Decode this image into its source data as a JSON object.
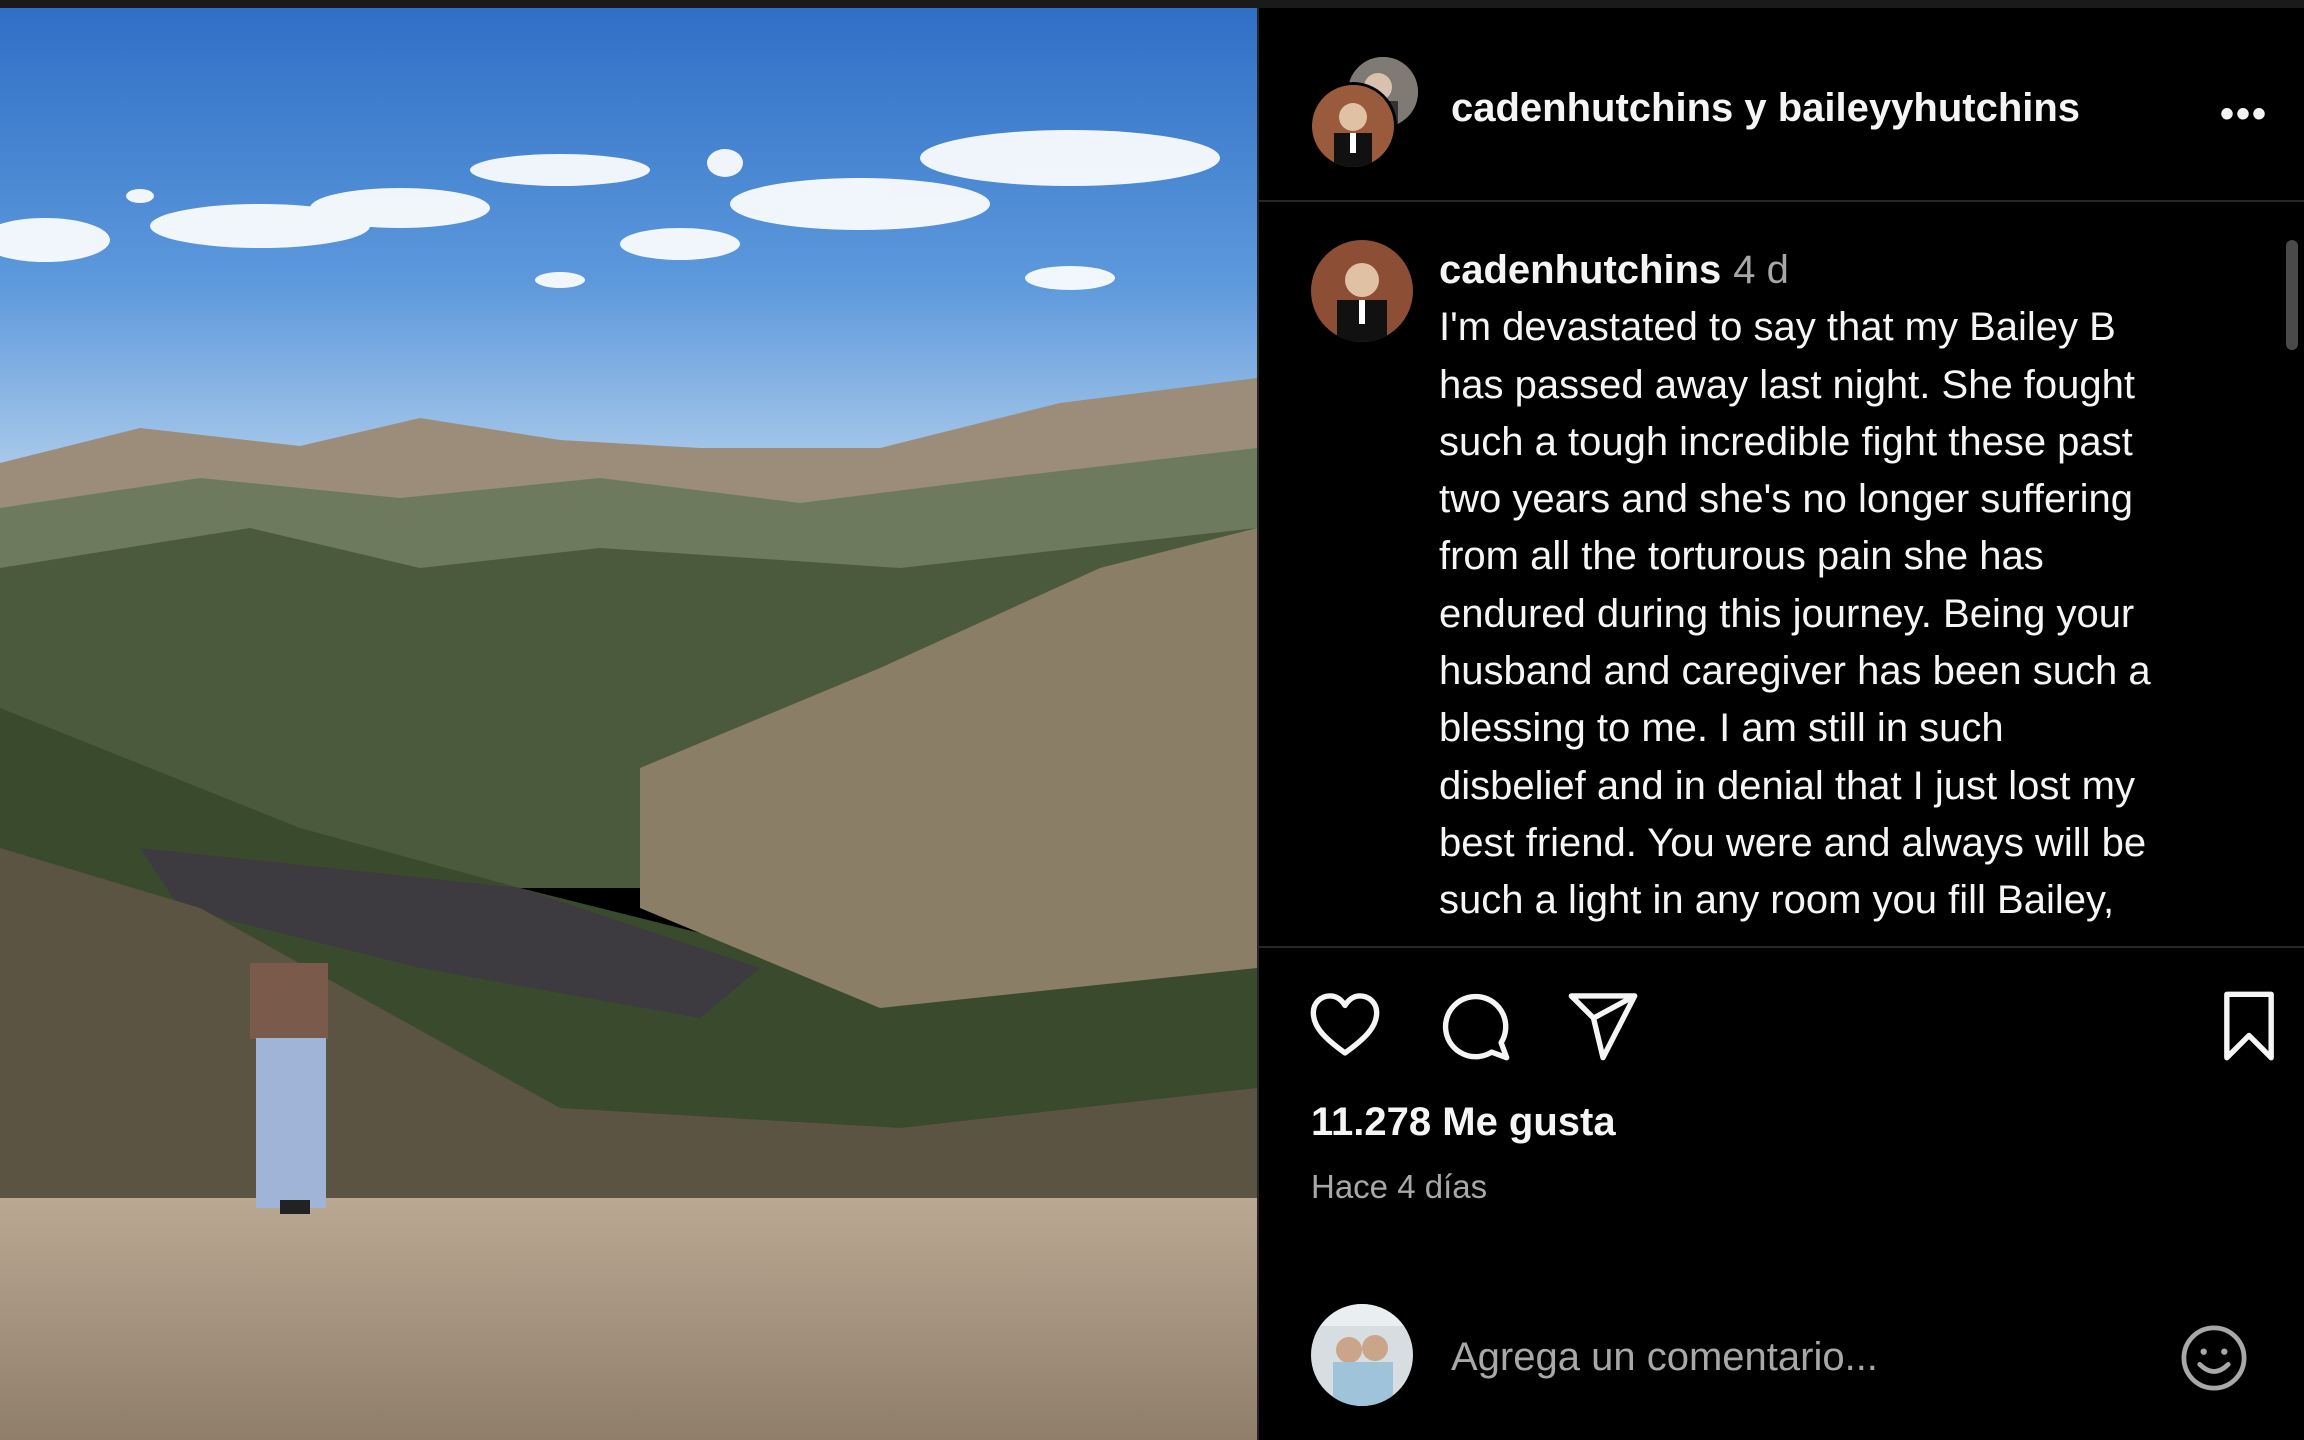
{
  "post": {
    "header": {
      "users_line": "cadenhutchins y baileyyhutchins",
      "more_label": "•••"
    },
    "caption": {
      "username": "cadenhutchins",
      "time": "4 d",
      "text": "I'm devastated to say that my Bailey B\nhas passed away last night. She fought\nsuch a tough incredible fight these past\ntwo years and she's no longer suffering\nfrom all the torturous pain she has\nendured during this journey. Being your\nhusband and caregiver has been such a\nblessing to me. I am still in such\ndisbelief and in denial that I just lost my\nbest friend. You were and always will be\nsuch a light in any room you fill Bailey,"
    },
    "actions": {
      "like_icon": "heart-icon",
      "comment_icon": "comment-bubble-icon",
      "share_icon": "paper-plane-icon",
      "save_icon": "bookmark-icon"
    },
    "likes_text": "11.278 Me gusta",
    "posted_ago": "Hace 4 días",
    "comment_box": {
      "placeholder": "Agrega un comentario...",
      "emoji_icon": "smiley-icon"
    }
  },
  "colors": {
    "background": "#000000",
    "text": "#f5f5f5",
    "secondary_text": "#a8a8a8",
    "divider": "#262626"
  }
}
